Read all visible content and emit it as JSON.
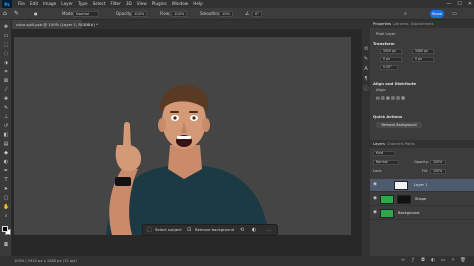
{
  "app": {
    "logo": "Ps",
    "menu": [
      "File",
      "Edit",
      "Image",
      "Layer",
      "Type",
      "Select",
      "Filter",
      "3D",
      "View",
      "Plugins",
      "Window",
      "Help"
    ],
    "window_controls": [
      "—",
      "☐",
      "✕"
    ]
  },
  "options": {
    "mode_label": "Mode:",
    "mode_value": "Normal",
    "opacity_label": "Opacity:",
    "opacity_value": "100%",
    "flow_label": "Flow:",
    "flow_value": "100%",
    "smoothing_label": "Smoothing:",
    "smoothing_value": "10%",
    "angle_value": "0°",
    "share_label": "Share"
  },
  "document": {
    "tab_title": "color-spill.psb @ 100% (Layer 1, RGB/8#) *",
    "close_glyph": "×",
    "status_text": "100% | 1920 px x 1080 px (72 ppi)"
  },
  "taskbar": {
    "select_subject": "Select subject",
    "remove_background": "Remove background",
    "more": "…"
  },
  "properties": {
    "tabs": [
      "Properties",
      "Libraries",
      "Adjustments"
    ],
    "pixel_layer": "Pixel Layer",
    "transform_title": "Transform",
    "w_value": "1920 px",
    "h_value": "1080 px",
    "x_value": "0 px",
    "y_value": "0 px",
    "angle_value": "0.00°",
    "align_title": "Align and Distribute",
    "align_label": "Align:",
    "quick_actions_title": "Quick Actions",
    "remove_bg_button": "Remove Background"
  },
  "layers": {
    "tabs": [
      "Layers",
      "Channels",
      "Paths"
    ],
    "kind_label": "Kind",
    "blend_mode": "Normal",
    "opacity_label": "Opacity:",
    "opacity_value": "100%",
    "lock_label": "Lock:",
    "fill_label": "Fill:",
    "fill_value": "100%",
    "items": [
      {
        "name": "Layer 1"
      },
      {
        "name": "Shape"
      },
      {
        "name": "Background"
      }
    ]
  },
  "colors": {
    "accent": "#1473e6",
    "selected_layer": "#4e5a6e",
    "canvas_bg": "#454545",
    "shirt": "#1b3a44",
    "green_screen": "#2fa84a"
  }
}
